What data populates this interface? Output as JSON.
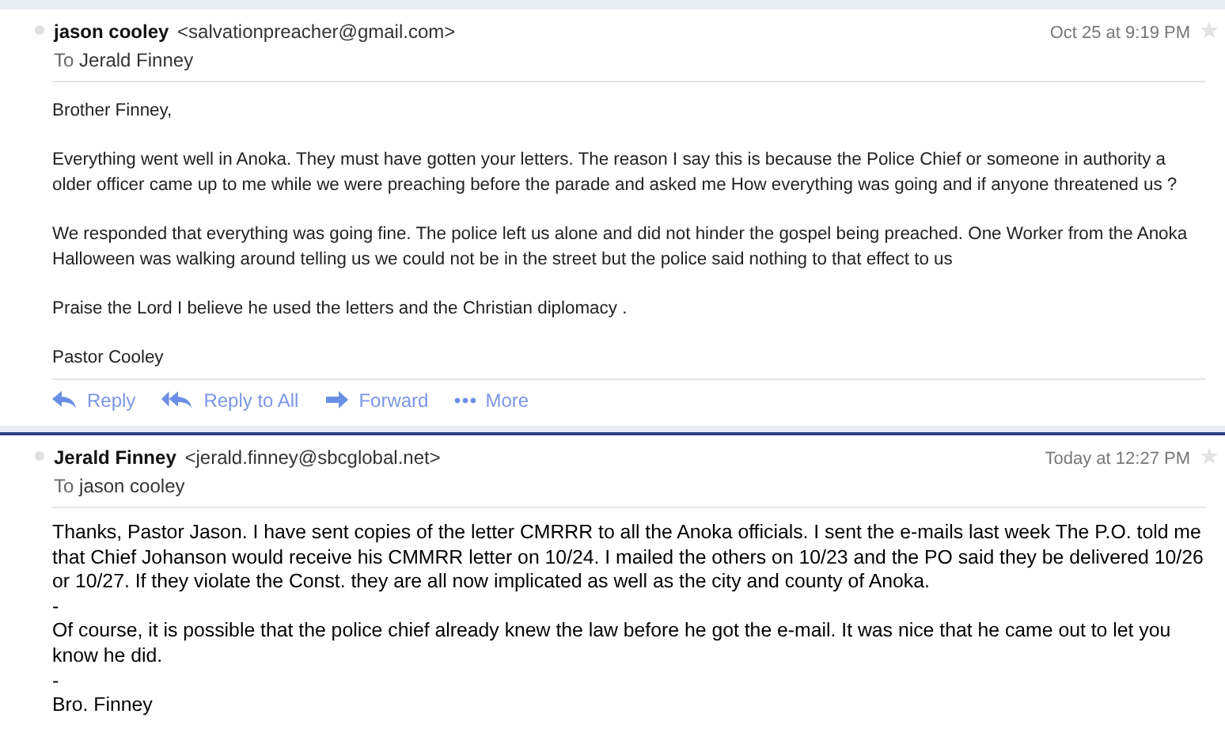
{
  "messages": [
    {
      "sender_name": "jason cooley",
      "sender_email": "<salvationpreacher@gmail.com>",
      "date": "Oct 25 at 9:19 PM",
      "to_label": "To",
      "recipient": "Jerald Finney",
      "paragraphs": [
        "Brother Finney,",
        "Everything went well in Anoka. They must have gotten your letters. The reason I say this is because the Police Chief or someone in authority a older officer came up to me while we were preaching before the parade and asked me How everything was going and if anyone threatened us ?",
        "We responded that everything was going fine. The police left us alone and did not hinder the gospel being preached. One Worker from the Anoka Halloween was walking around telling us we could not be in the street but the police said nothing to that effect to us",
        "Praise the Lord I believe he used the letters and the Christian diplomacy .",
        "Pastor Cooley"
      ],
      "actions": [
        {
          "kind": "reply",
          "label": "Reply"
        },
        {
          "kind": "reply-all",
          "label": "Reply to All"
        },
        {
          "kind": "forward",
          "label": "Forward"
        },
        {
          "kind": "more",
          "label": "More"
        }
      ]
    },
    {
      "sender_name": "Jerald Finney",
      "sender_email": "<jerald.finney@sbcglobal.net>",
      "date": "Today at 12:27 PM",
      "to_label": "To",
      "recipient": "jason cooley",
      "paragraphs": [
        "Thanks, Pastor Jason. I have sent copies of the letter CMRRR to all the Anoka officials. I sent the e-mails last week The P.O. told me that Chief Johanson would receive his CMMRR letter on 10/24. I mailed the others on 10/23 and the PO said they be delivered 10/26 or 10/27. If they violate the Const. they are all now implicated as well as the city and county of Anoka.",
        "-",
        "Of course, it is possible that the police chief already knew the law before he got the e-mail. It was nice that he came out to let you know he did.",
        "-",
        "Bro. Finney"
      ]
    }
  ]
}
